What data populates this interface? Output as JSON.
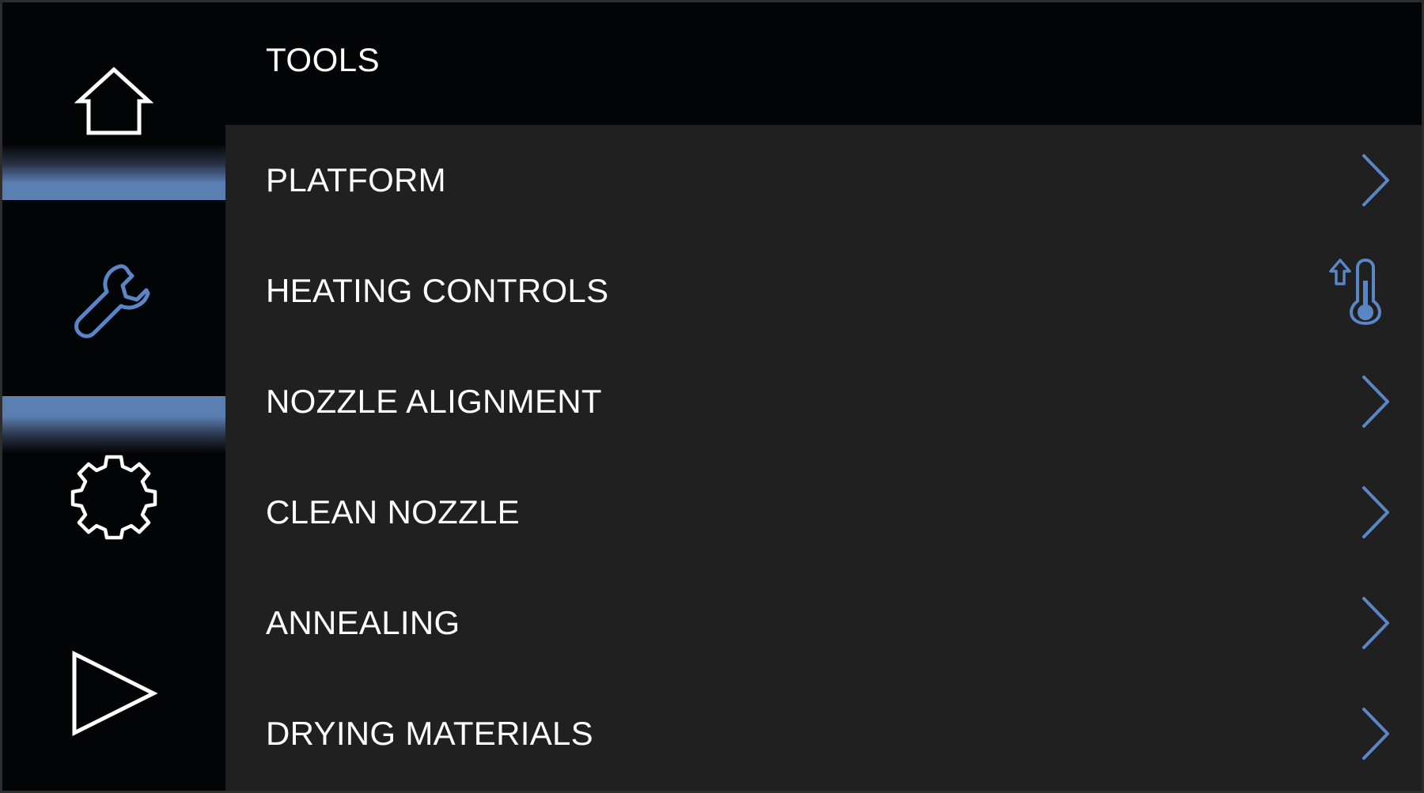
{
  "header": {
    "title": "TOOLS"
  },
  "sidebar": {
    "items": [
      {
        "name": "home",
        "icon": "home-icon"
      },
      {
        "name": "tools",
        "icon": "wrench-icon",
        "selected": true
      },
      {
        "name": "settings",
        "icon": "gear-icon"
      },
      {
        "name": "print",
        "icon": "play-icon"
      }
    ]
  },
  "menu": {
    "items": [
      {
        "label": "PLATFORM",
        "icon": "chevron-right-icon"
      },
      {
        "label": "HEATING CONTROLS",
        "icon": "thermometer-up-icon"
      },
      {
        "label": "NOZZLE ALIGNMENT",
        "icon": "chevron-right-icon"
      },
      {
        "label": "CLEAN NOZZLE",
        "icon": "chevron-right-icon"
      },
      {
        "label": "ANNEALING",
        "icon": "chevron-right-icon"
      },
      {
        "label": "DRYING MATERIALS",
        "icon": "chevron-right-icon"
      }
    ]
  },
  "colors": {
    "accent": "#5a86c5",
    "background": "#202021",
    "sidebar": "#030405",
    "text": "#ffffff"
  }
}
